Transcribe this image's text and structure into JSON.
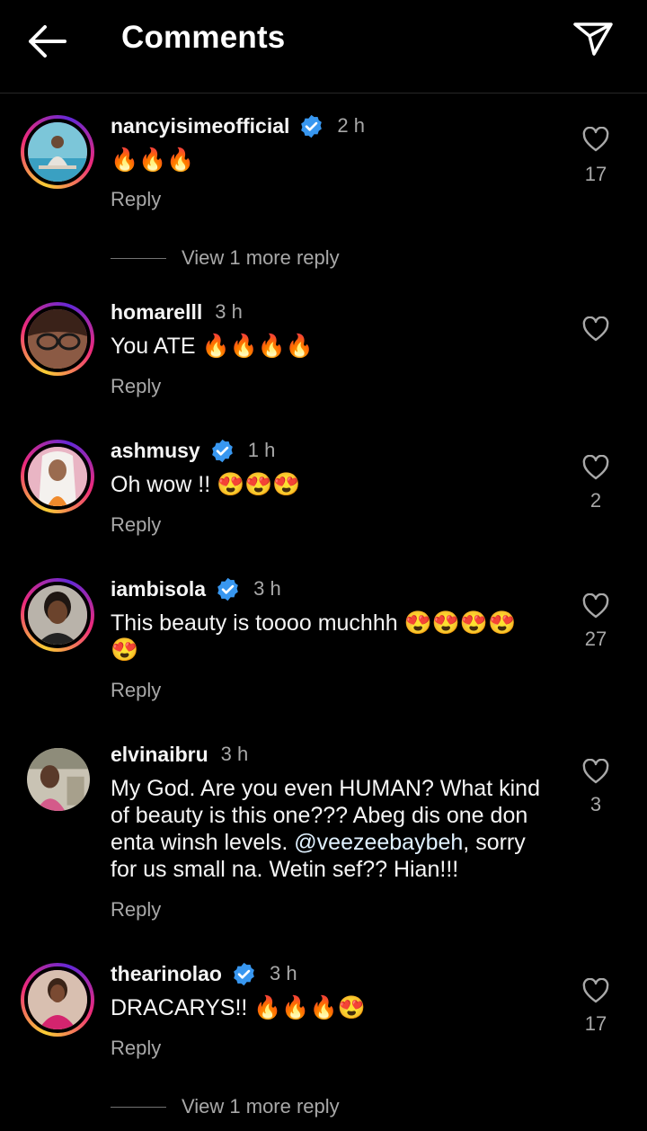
{
  "header": {
    "title": "Comments",
    "back_icon": "arrow-left-icon",
    "share_icon": "paper-plane-icon"
  },
  "reply_label": "Reply",
  "view_more_label": "View 1 more reply",
  "colors": {
    "background": "#000000",
    "verified": "#3897f0",
    "secondary_text": "#a8a8a8"
  },
  "comments": [
    {
      "username": "nancyisimeofficial",
      "verified": true,
      "time": "2 h",
      "text": "🔥🔥🔥",
      "likes": "17",
      "view_more": true
    },
    {
      "username": "homarelll",
      "verified": false,
      "time": "3 h",
      "text": "You ATE 🔥🔥🔥🔥",
      "likes": "",
      "view_more": false
    },
    {
      "username": "ashmusy",
      "verified": true,
      "time": "1 h",
      "text": "Oh wow !! 😍😍😍",
      "likes": "2",
      "view_more": false
    },
    {
      "username": "iambisola",
      "verified": true,
      "time": "3 h",
      "text": "This beauty is toooo muchhh 😍😍😍😍😍",
      "likes": "27",
      "view_more": false
    },
    {
      "username": "elvinaibru",
      "verified": false,
      "time": "3 h",
      "text_before": "My God. Are you even HUMAN? What kind of beauty is this one??? Abeg dis one don enta winsh levels. ",
      "mention": "@veezeebaybeh",
      "text_after": ", sorry for us small na. Wetin sef?? Hian!!!",
      "likes": "3",
      "view_more": false
    },
    {
      "username": "thearinolao",
      "verified": true,
      "time": "3 h",
      "text": "DRACARYS!! 🔥🔥🔥😍",
      "likes": "17",
      "view_more": true
    }
  ]
}
